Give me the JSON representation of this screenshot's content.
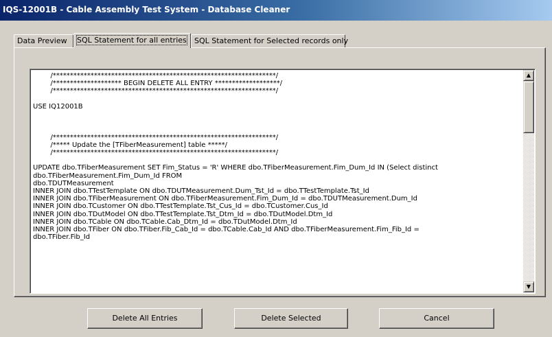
{
  "window": {
    "title": "IQS-12001B - Cable Assembly Test System - Database Cleaner"
  },
  "tabs": [
    {
      "label": "Data Preview",
      "active": false
    },
    {
      "label": "SQL Statement for all entries",
      "active": true
    },
    {
      "label": "SQL Statement for Selected records only",
      "active": false
    }
  ],
  "sql_text": "        /*****************************************************************/\n        /******************** BEGIN DELETE ALL ENTRY *******************/\n        /*****************************************************************/\n\nUSE IQ12001B\n\n\n\n        /*****************************************************************/\n        /***** Update the [TFiberMeasurement] table *****/\n        /*****************************************************************/\n\nUPDATE dbo.TFiberMeasurement SET Fim_Status = 'R' WHERE dbo.TFiberMeasurement.Fim_Dum_Id IN (Select distinct\ndbo.TFiberMeasurement.Fim_Dum_Id FROM\ndbo.TDUTMeasurement\nINNER JOIN dbo.TTestTemplate ON dbo.TDUTMeasurement.Dum_Tst_Id = dbo.TTestTemplate.Tst_Id\nINNER JOIN dbo.TFiberMeasurement ON dbo.TFiberMeasurement.Fim_Dum_Id = dbo.TDUTMeasurement.Dum_Id\nINNER JOIN dbo.TCustomer ON dbo.TTestTemplate.Tst_Cus_Id = dbo.TCustomer.Cus_Id\nINNER JOIN dbo.TDutModel ON dbo.TTestTemplate.Tst_Dtm_Id = dbo.TDutModel.Dtm_Id\nINNER JOIN dbo.TCable ON dbo.TCable.Cab_Dtm_Id = dbo.TDutModel.Dtm_Id\nINNER JOIN dbo.TFiber ON dbo.TFiber.Fib_Cab_Id = dbo.TCable.Cab_Id AND dbo.TFiberMeasurement.Fim_Fib_Id =\ndbo.TFiber.Fib_Id",
  "buttons": {
    "delete_all": "Delete All Entries",
    "delete_selected": "Delete Selected",
    "cancel": "Cancel"
  },
  "icons": {
    "scroll_up": "scroll-up-arrow-icon",
    "scroll_down": "scroll-down-arrow-icon"
  },
  "colors": {
    "face": "#d4d0c8",
    "title_start": "#0a246a",
    "title_end": "#a6caf0"
  }
}
